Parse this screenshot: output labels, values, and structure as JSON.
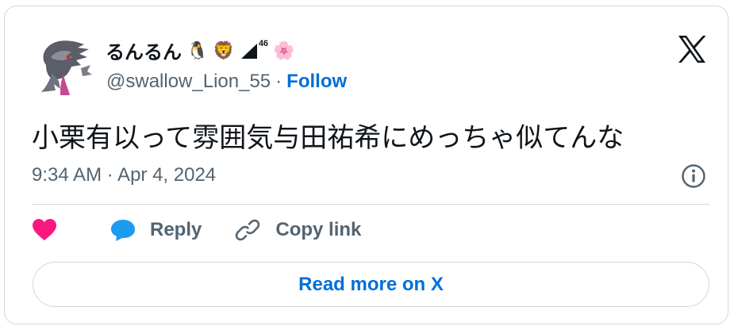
{
  "author": {
    "display_name": "るんるん",
    "name_emojis": [
      "🐧",
      "🦁"
    ],
    "signal_superscript": "46",
    "trailing_emoji": "🌸",
    "handle": "@swallow_Lion_55",
    "separator": "·",
    "follow_label": "Follow"
  },
  "tweet": {
    "text": "小栗有以って雰囲気与田祐希にめっちゃ似てんな",
    "timestamp": "9:34 AM · Apr 4, 2024"
  },
  "actions": {
    "reply_label": "Reply",
    "copy_link_label": "Copy link"
  },
  "read_more_label": "Read more on X",
  "colors": {
    "link": "#006fd6",
    "heart": "#f91880",
    "reply_bubble": "#1d9bf0",
    "text": "#0f1419",
    "muted": "#536471",
    "border": "#cfd9de"
  },
  "icons": [
    "avatar",
    "penguin-emoji",
    "lion-emoji",
    "signal-icon",
    "cherry-blossom-emoji",
    "x-logo-icon",
    "info-icon",
    "heart-icon",
    "reply-bubble-icon",
    "link-icon"
  ]
}
